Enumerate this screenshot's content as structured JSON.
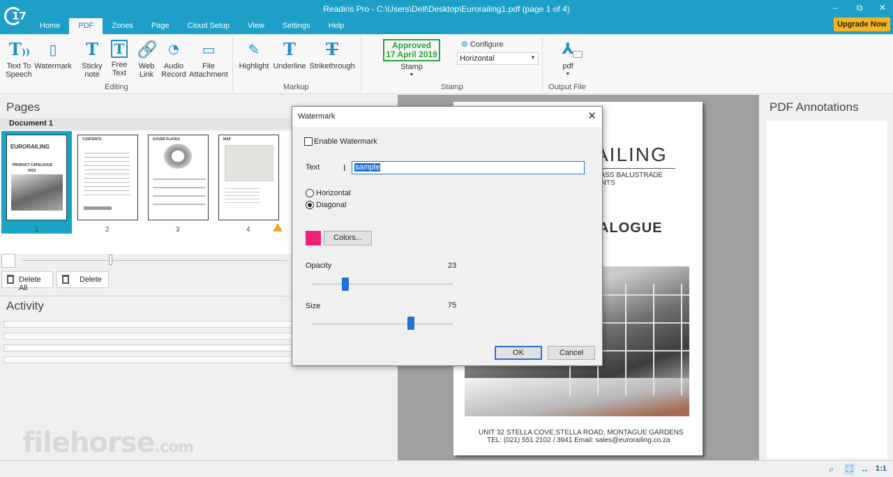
{
  "window": {
    "title": "Readiris Pro - C:\\Users\\Dell\\Desktop\\Eurorailing1.pdf (page 1 of 4)",
    "logo_text": "17",
    "minimize": "–",
    "restore": "⧉",
    "close": "✕"
  },
  "menu_tabs": [
    "Home",
    "PDF",
    "Zones",
    "Page",
    "Cloud Setup",
    "View",
    "Settings",
    "Help"
  ],
  "active_tab": "PDF",
  "upgrade_label": "Upgrade Now",
  "ribbon": {
    "editing": {
      "label": "Editing",
      "items": [
        {
          "label": "Text To\nSpeech",
          "icon": "text-to-speech-icon"
        },
        {
          "label": "Watermark",
          "icon": "watermark-icon"
        },
        {
          "label": "Sticky\nnote",
          "icon": "sticky-note-icon"
        },
        {
          "label": "Free\nText",
          "icon": "free-text-icon"
        },
        {
          "label": "Web\nLink",
          "icon": "web-link-icon"
        },
        {
          "label": "Audio\nRecord",
          "icon": "audio-record-icon"
        },
        {
          "label": "File\nAttachment",
          "icon": "file-attachment-icon"
        }
      ]
    },
    "markup": {
      "label": "Markup",
      "items": [
        {
          "label": "Highlight",
          "icon": "highlight-icon"
        },
        {
          "label": "Underline",
          "icon": "underline-icon"
        },
        {
          "label": "Strikethrough",
          "icon": "strikethrough-icon"
        }
      ]
    },
    "stamp": {
      "label": "Stamp",
      "stamp_line1": "Approved",
      "stamp_line2": "17 April 2019",
      "stamp_button": "Stamp",
      "configure": "Configure",
      "orientation": "Horizontal"
    },
    "output": {
      "label": "Output File",
      "format": "pdf"
    }
  },
  "pages_panel": {
    "title": "Pages",
    "document_label": "Document 1",
    "pages": [
      "1",
      "2",
      "3",
      "4"
    ],
    "selected_page": "1",
    "delete_all": "Delete All",
    "delete": "Delete"
  },
  "thumb_text": {
    "brand": "EURORAILING",
    "catalogue": "PRODUCT CATALOGUE",
    "year": "2015",
    "contents": "CONTENTS",
    "cover_plates": "COVER PLATES",
    "map": "MAP"
  },
  "activity_panel": {
    "title": "Activity"
  },
  "document_page": {
    "brand_fragment": "AILING",
    "tagline_line1": "LASS BALUSTRADE",
    "tagline_line2": "ENTS",
    "catalogue_fragment": "ALOGUE",
    "address_line1": "UNIT 32 STELLA COVE,STELLA ROAD, MONTAGUE GARDENS",
    "address_line2": "TEL: (021) 551  2102 / 3941  Email: sales@eurorailing.co.za"
  },
  "annotations_panel": {
    "title": "PDF Annotations"
  },
  "watermark_dialog": {
    "title": "Watermark",
    "enable_label": "Enable Watermark",
    "enabled": false,
    "text_label": "Text",
    "text_value": "sample",
    "orientation_options": [
      "Horizontal",
      "Diagonal"
    ],
    "orientation_selected": "Diagonal",
    "color": "#f0207a",
    "colors_button": "Colors...",
    "opacity_label": "Opacity",
    "opacity_value": "23",
    "size_label": "Size",
    "size_value": "75",
    "ok": "OK",
    "cancel": "Cancel"
  },
  "site_watermark": {
    "name": "filehorse",
    "tld": ".com"
  },
  "statusbar": {
    "zoom_ratio": "1:1"
  },
  "colors": {
    "titlebar": "#1e9fc7",
    "accent": "#1f73d6",
    "upgrade": "#f6b51e",
    "stamp_green": "#29a337"
  }
}
